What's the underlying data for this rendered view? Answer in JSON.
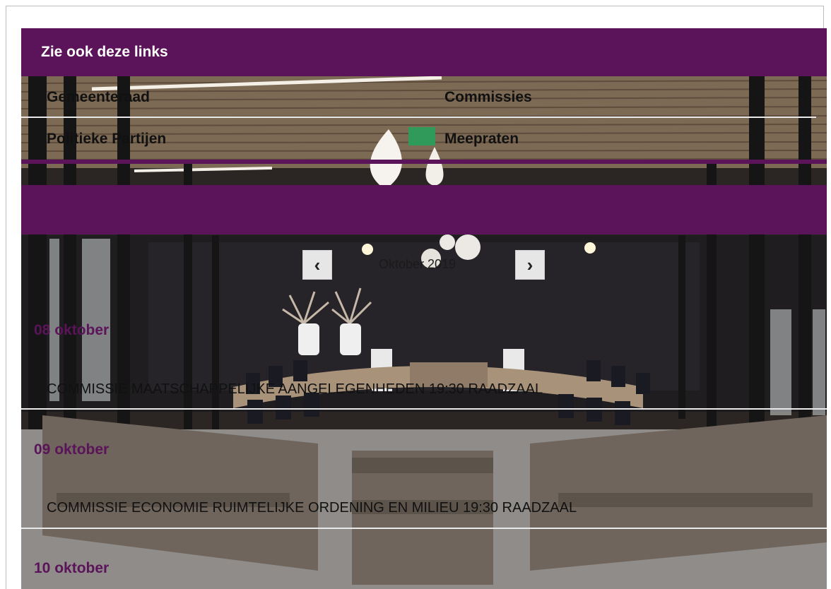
{
  "links_section": {
    "title": "Zie ook deze links",
    "links": [
      {
        "label": "Gemeenteraad"
      },
      {
        "label": "Commissies"
      },
      {
        "label": "Politieke Partijen"
      },
      {
        "label": "Meepraten"
      }
    ]
  },
  "calendar": {
    "month_label": "Oktober 2019",
    "prev_icon": "chevron-left-icon",
    "next_icon": "chevron-right-icon",
    "days": [
      {
        "date": "08 oktober",
        "events": [
          "COMMISSIE MAATSCHAPPELIJKE AANGELEGENHEDEN 19:30 RAADZAAL"
        ]
      },
      {
        "date": "09 oktober",
        "events": [
          "COMMISSIE ECONOMIE RUIMTELIJKE ORDENING EN MILIEU 19:30 RAADZAAL"
        ]
      },
      {
        "date": "10 oktober",
        "events": []
      }
    ]
  },
  "colors": {
    "accent": "#5b1459",
    "date_text": "#5b1459",
    "background_photo": "#2b2623"
  }
}
